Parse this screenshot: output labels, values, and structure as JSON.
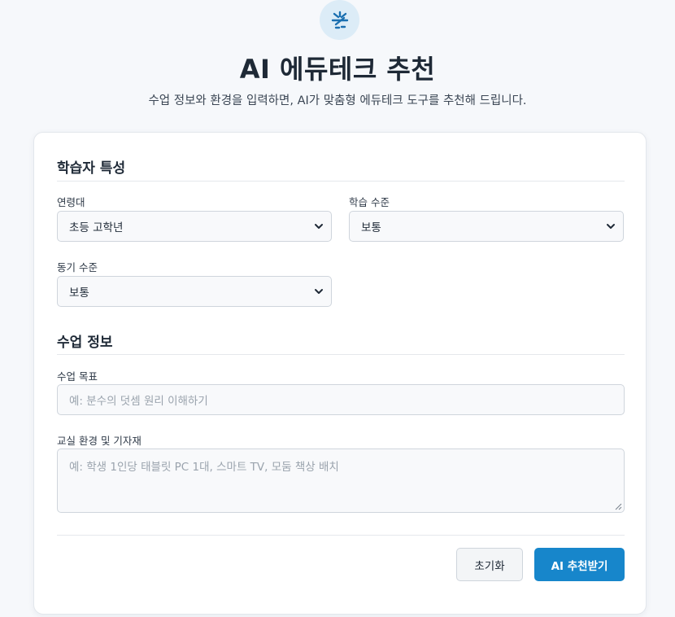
{
  "header": {
    "title": "AI 에듀테크 추천",
    "subtitle": "수업 정보와 환경을 입력하면, AI가 맞춤형 에듀테크 도구를 추천해 드립니다.",
    "logo_icon": "sparkle-icon"
  },
  "learner_section": {
    "title": "학습자 특성",
    "age": {
      "label": "연령대",
      "value": "초등 고학년"
    },
    "level": {
      "label": "학습 수준",
      "value": "보통"
    },
    "motivation": {
      "label": "동기 수준",
      "value": "보통"
    }
  },
  "class_section": {
    "title": "수업 정보",
    "goal": {
      "label": "수업 목표",
      "value": "",
      "placeholder": "예: 분수의 덧셈 원리 이해하기"
    },
    "environment": {
      "label": "교실 환경 및 기자재",
      "value": "",
      "placeholder": "예: 학생 1인당 태블릿 PC 1대, 스마트 TV, 모둠 책상 배치"
    }
  },
  "actions": {
    "reset_label": "초기화",
    "submit_label": "AI 추천받기"
  },
  "colors": {
    "accent": "#1786cb",
    "logo_bg": "#dcecf7",
    "page_bg": "#f6f8fb"
  }
}
